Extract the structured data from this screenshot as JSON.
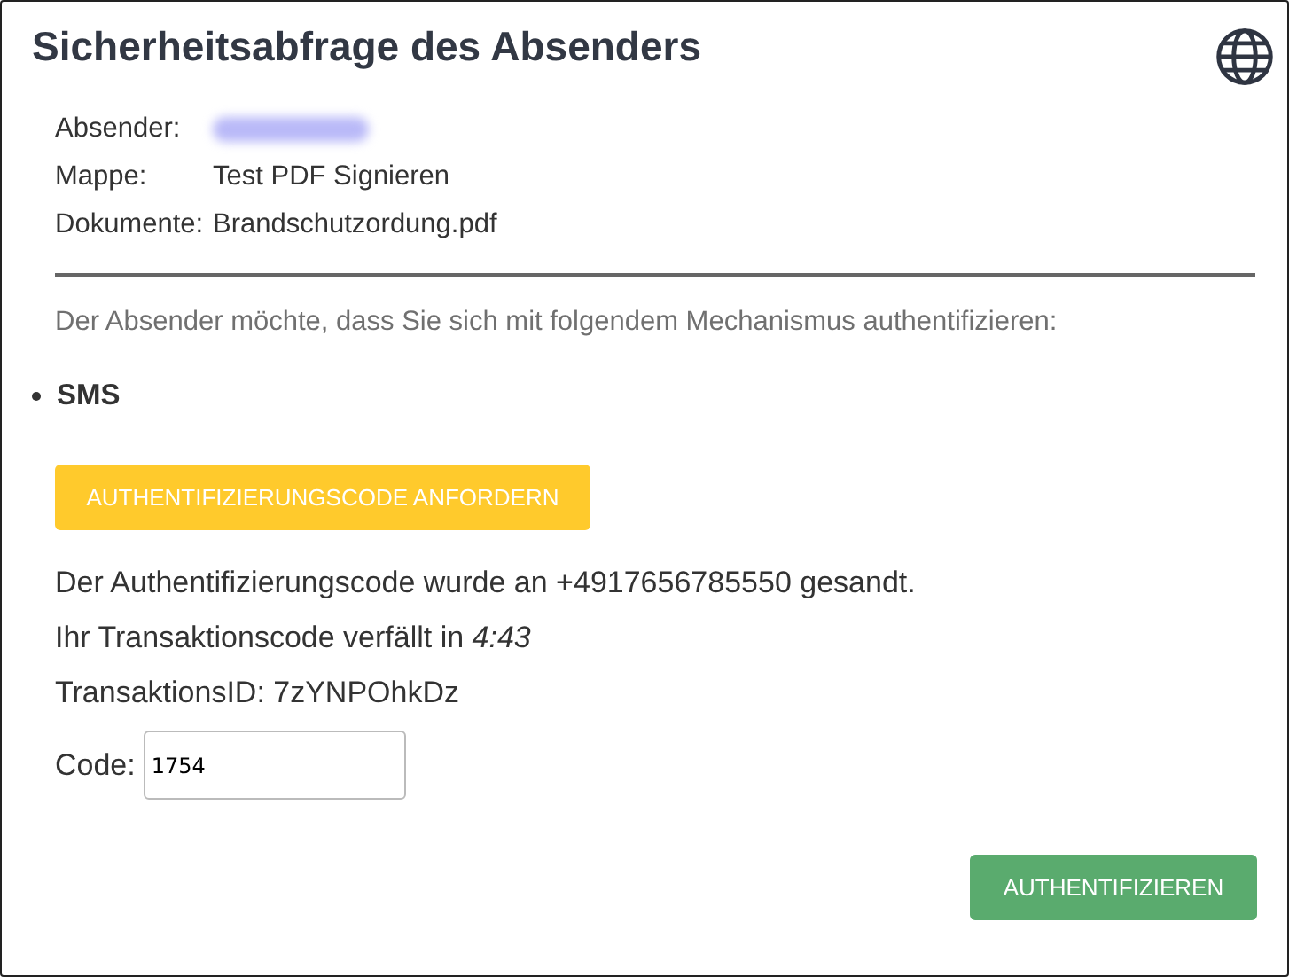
{
  "title": "Sicherheitsabfrage des Absenders",
  "details": [
    {
      "label": "Absender:",
      "value_blurred": true
    },
    {
      "label": "Mappe:",
      "value": "Test PDF Signieren"
    },
    {
      "label": "Dokumente:",
      "value": "Brandschutzordung.pdf"
    }
  ],
  "instruction": "Der Absender möchte, dass Sie sich mit folgendem Mechanismus authentifizieren:",
  "mechanisms": [
    "SMS"
  ],
  "request_button": "AUTHENTIFIZIERUNGSCODE ANFORDERN",
  "messages": [
    "Der Authentifizierungscode wurde an +4917656785550 gesandt.",
    "Ihr Transaktionscode verfällt in *4:43*",
    "TransaktionsID: 7zYNPOhkDz"
  ],
  "code_field": {
    "label": "Code:",
    "value": "1754"
  },
  "submit_button": "AUTHENTIFIZIEREN"
}
